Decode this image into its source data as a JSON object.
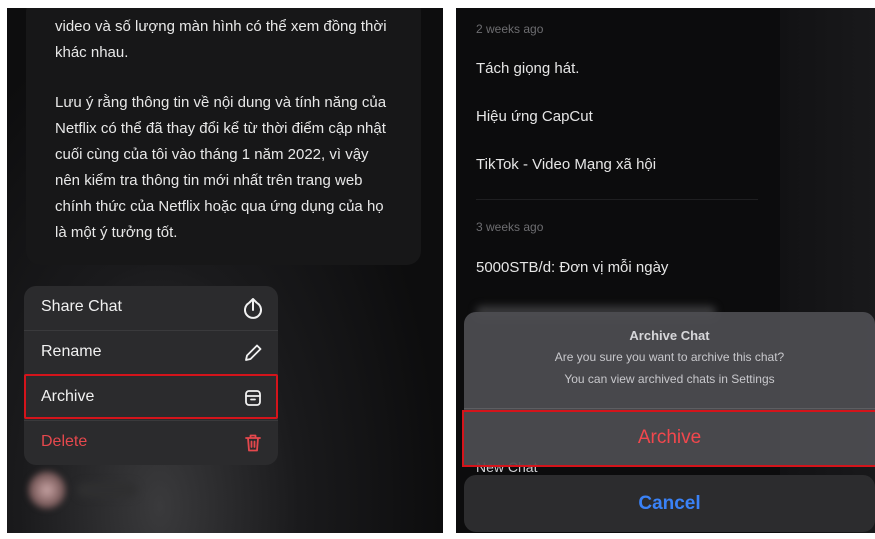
{
  "left": {
    "message_paragraph_1": "video và số lượng màn hình có thể xem đồng thời khác nhau.",
    "message_paragraph_2": "Lưu ý rằng thông tin về nội dung và tính năng của Netflix có thể đã thay đổi kể từ thời điểm cập nhật cuối cùng của tôi vào tháng 1 năm 2022, vì vậy nên kiểm tra thông tin mới nhất trên trang web chính thức của Netflix hoặc qua ứng dụng của họ là một ý tưởng tốt.",
    "menu": [
      {
        "label": "Share Chat",
        "icon": "share-icon"
      },
      {
        "label": "Rename",
        "icon": "pencil-icon"
      },
      {
        "label": "Archive",
        "icon": "archive-icon"
      },
      {
        "label": "Delete",
        "icon": "trash-icon"
      }
    ],
    "delete_color": "#e5484d",
    "highlight_color": "#d4141b"
  },
  "right": {
    "section_1": "2 weeks ago",
    "items_1": [
      "Tách giọng hát.",
      "Hiệu ứng CapCut",
      "TikTok - Video Mạng xã hội"
    ],
    "section_2": "3 weeks ago",
    "items_2": [
      "5000STB/d: Đơn vị mỗi ngày"
    ],
    "new_chat": "New Chat",
    "dialog": {
      "title": "Archive Chat",
      "message_line_1": "Are you sure you want to archive this chat?",
      "message_line_2": "You can view archived chats in Settings",
      "confirm_label": "Archive",
      "cancel_label": "Cancel"
    },
    "confirm_color": "#f2474d",
    "cancel_color": "#3a82f7"
  }
}
